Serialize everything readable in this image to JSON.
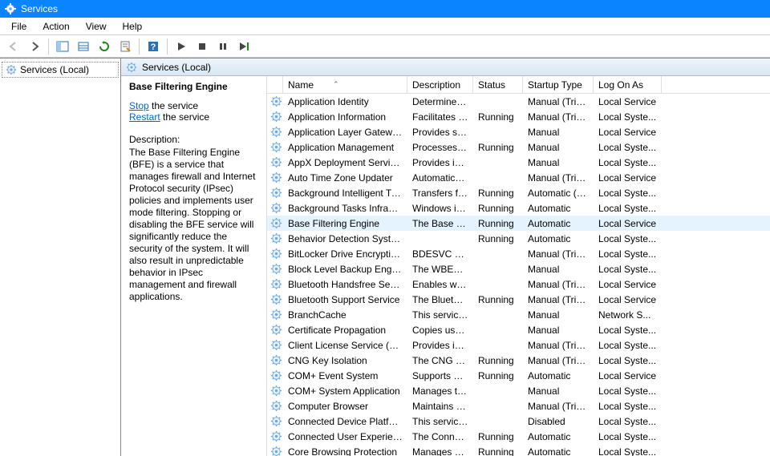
{
  "window": {
    "title": "Services"
  },
  "menubar": [
    "File",
    "Action",
    "View",
    "Help"
  ],
  "toolbar": [
    {
      "name": "back-icon",
      "disabled": true
    },
    {
      "name": "forward-icon",
      "disabled": false
    },
    {
      "sep": true
    },
    {
      "name": "show-hide-tree-icon"
    },
    {
      "name": "export-list-icon"
    },
    {
      "name": "refresh-icon"
    },
    {
      "name": "properties-icon"
    },
    {
      "sep": true
    },
    {
      "name": "help-icon"
    },
    {
      "sep": true
    },
    {
      "name": "start-service-icon",
      "disabled": false
    },
    {
      "name": "stop-service-icon"
    },
    {
      "name": "pause-service-icon"
    },
    {
      "name": "restart-service-icon"
    }
  ],
  "tree": {
    "root_label": "Services (Local)"
  },
  "pane_title": "Services (Local)",
  "detail": {
    "service_name": "Base Filtering Engine",
    "stop_link": "Stop",
    "stop_suffix": " the service",
    "restart_link": "Restart",
    "restart_suffix": " the service",
    "desc_label": "Description:",
    "desc_text": "The Base Filtering Engine (BFE) is a service that manages firewall and Internet Protocol security (IPsec) policies and implements user mode filtering. Stopping or disabling the BFE service will significantly reduce the security of the system. It will also result in unpredictable behavior in IPsec management and firewall applications."
  },
  "columns": {
    "name": "Name",
    "description": "Description",
    "status": "Status",
    "startup": "Startup Type",
    "logon": "Log On As"
  },
  "services": [
    {
      "name": "Application Identity",
      "desc": "Determines ...",
      "status": "",
      "startup": "Manual (Trig...",
      "logon": "Local Service"
    },
    {
      "name": "Application Information",
      "desc": "Facilitates t...",
      "status": "Running",
      "startup": "Manual (Trig...",
      "logon": "Local Syste..."
    },
    {
      "name": "Application Layer Gateway ...",
      "desc": "Provides su...",
      "status": "",
      "startup": "Manual",
      "logon": "Local Service"
    },
    {
      "name": "Application Management",
      "desc": "Processes in...",
      "status": "Running",
      "startup": "Manual",
      "logon": "Local Syste..."
    },
    {
      "name": "AppX Deployment Service (...",
      "desc": "Provides inf...",
      "status": "",
      "startup": "Manual",
      "logon": "Local Syste..."
    },
    {
      "name": "Auto Time Zone Updater",
      "desc": "Automatica...",
      "status": "",
      "startup": "Manual (Trig...",
      "logon": "Local Service"
    },
    {
      "name": "Background Intelligent Tran...",
      "desc": "Transfers fil...",
      "status": "Running",
      "startup": "Automatic (D...",
      "logon": "Local Syste..."
    },
    {
      "name": "Background Tasks Infrastru...",
      "desc": "Windows in...",
      "status": "Running",
      "startup": "Automatic",
      "logon": "Local Syste..."
    },
    {
      "name": "Base Filtering Engine",
      "desc": "The Base Fil...",
      "status": "Running",
      "startup": "Automatic",
      "logon": "Local Service",
      "selected": true
    },
    {
      "name": "Behavior Detection System",
      "desc": "",
      "status": "Running",
      "startup": "Automatic",
      "logon": "Local Syste..."
    },
    {
      "name": "BitLocker Drive Encryption ...",
      "desc": "BDESVC hos...",
      "status": "",
      "startup": "Manual (Trig...",
      "logon": "Local Syste..."
    },
    {
      "name": "Block Level Backup Engine ...",
      "desc": "The WBENG...",
      "status": "",
      "startup": "Manual",
      "logon": "Local Syste..."
    },
    {
      "name": "Bluetooth Handsfree Service",
      "desc": "Enables wir...",
      "status": "",
      "startup": "Manual (Trig...",
      "logon": "Local Service"
    },
    {
      "name": "Bluetooth Support Service",
      "desc": "The Bluetoo...",
      "status": "Running",
      "startup": "Manual (Trig...",
      "logon": "Local Service"
    },
    {
      "name": "BranchCache",
      "desc": "This service ...",
      "status": "",
      "startup": "Manual",
      "logon": "Network S..."
    },
    {
      "name": "Certificate Propagation",
      "desc": "Copies user ...",
      "status": "",
      "startup": "Manual",
      "logon": "Local Syste..."
    },
    {
      "name": "Client License Service (ClipS...",
      "desc": "Provides inf...",
      "status": "",
      "startup": "Manual (Trig...",
      "logon": "Local Syste..."
    },
    {
      "name": "CNG Key Isolation",
      "desc": "The CNG ke...",
      "status": "Running",
      "startup": "Manual (Trig...",
      "logon": "Local Syste..."
    },
    {
      "name": "COM+ Event System",
      "desc": "Supports Sy...",
      "status": "Running",
      "startup": "Automatic",
      "logon": "Local Service"
    },
    {
      "name": "COM+ System Application",
      "desc": "Manages th...",
      "status": "",
      "startup": "Manual",
      "logon": "Local Syste..."
    },
    {
      "name": "Computer Browser",
      "desc": "Maintains a...",
      "status": "",
      "startup": "Manual (Trig...",
      "logon": "Local Syste..."
    },
    {
      "name": "Connected Device Platform...",
      "desc": "This service ...",
      "status": "",
      "startup": "Disabled",
      "logon": "Local Syste..."
    },
    {
      "name": "Connected User Experience...",
      "desc": "The Connec...",
      "status": "Running",
      "startup": "Automatic",
      "logon": "Local Syste..."
    },
    {
      "name": "Core Browsing Protection",
      "desc": "Manages se...",
      "status": "Running",
      "startup": "Automatic",
      "logon": "Local Syste..."
    }
  ]
}
